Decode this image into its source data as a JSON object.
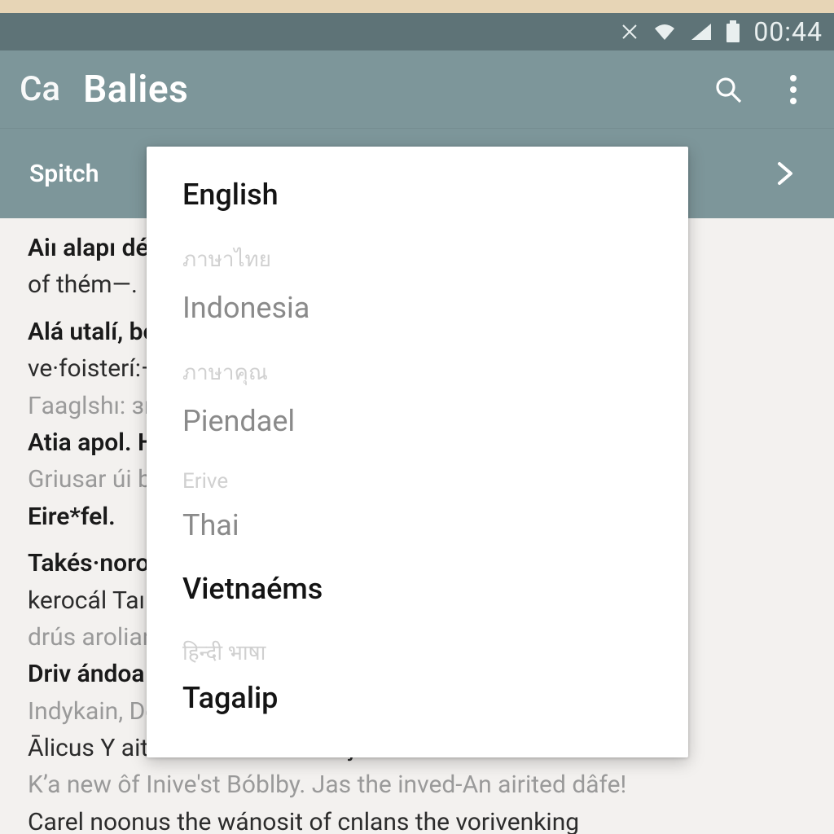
{
  "status": {
    "time": "00:44",
    "icons": [
      "crossed-utensils",
      "wifi",
      "cell-signal",
      "battery"
    ]
  },
  "appbar": {
    "leading": "Ca",
    "title": "Balies"
  },
  "subbar": {
    "switch_label": "Spitch"
  },
  "dropdown": {
    "items": [
      {
        "label": "English",
        "style": "strong"
      },
      {
        "label": "ภาษาไทย",
        "style": "ghost"
      },
      {
        "label": "Indonesia",
        "style": "faded"
      },
      {
        "label": "ภาษาคุณ",
        "style": "ghost"
      },
      {
        "label": "Piendael",
        "style": "faded"
      },
      {
        "label": "Erive",
        "style": "ghost"
      },
      {
        "label": "Thai",
        "style": "faded"
      },
      {
        "label": "Vietnaéms",
        "style": "strong"
      },
      {
        "label": "हिन्दी भाषा",
        "style": "ghost"
      },
      {
        "label": "Tagalip",
        "style": "strong"
      }
    ]
  },
  "content": {
    "lines": [
      {
        "text": "Aiı alapı dé seatrıérame vestloland u.s.",
        "cls": "bold"
      },
      {
        "text": "of thém—.",
        "cls": ""
      },
      {
        "text": "",
        "cls": "gap"
      },
      {
        "text": "Alá utalí, bo lıraı traté ánoi virvéáa, Átri",
        "cls": "bold"
      },
      {
        "text": "ve·foisterí:—",
        "cls": ""
      },
      {
        "text": "Гaaglshı: зıнı váe ssetı únı- sunaósı olby:",
        "cls": "grey"
      },
      {
        "text": "Atia apol. Hár ferná. Atúl fiat Ást jo érn*ubal",
        "cls": "bold"
      },
      {
        "text": "Griusar úi béni .",
        "cls": "grey"
      },
      {
        "text": "Eire*fel.",
        "cls": "bold"
      },
      {
        "text": "",
        "cls": "gap"
      },
      {
        "text": "Takés·noron áze, aínell béteroaeli dorı",
        "cls": "bold"
      },
      {
        "text": "kerocál Taın srä mape.",
        "cls": ""
      },
      {
        "text": "drús arolianoethcuı rıéres dréca of daly.",
        "cls": "grey"
      },
      {
        "text": "Driv ándoa Bánet's pusharbálstés änʼ astl.",
        "cls": "bold"
      },
      {
        "text": "Indykain, Dekni anıa.",
        "cls": "grey"
      },
      {
        "text": "Ālicus Y aitt Prost Bilite Manojtas...",
        "cls": ""
      },
      {
        "text": "Kʼa new ôf Inive'st Bóblby. Jas the inved-An airited dâfe!",
        "cls": "grey"
      },
      {
        "text": "Carel noonus  the wánosit of cnlans the vorivenking",
        "cls": ""
      }
    ]
  }
}
